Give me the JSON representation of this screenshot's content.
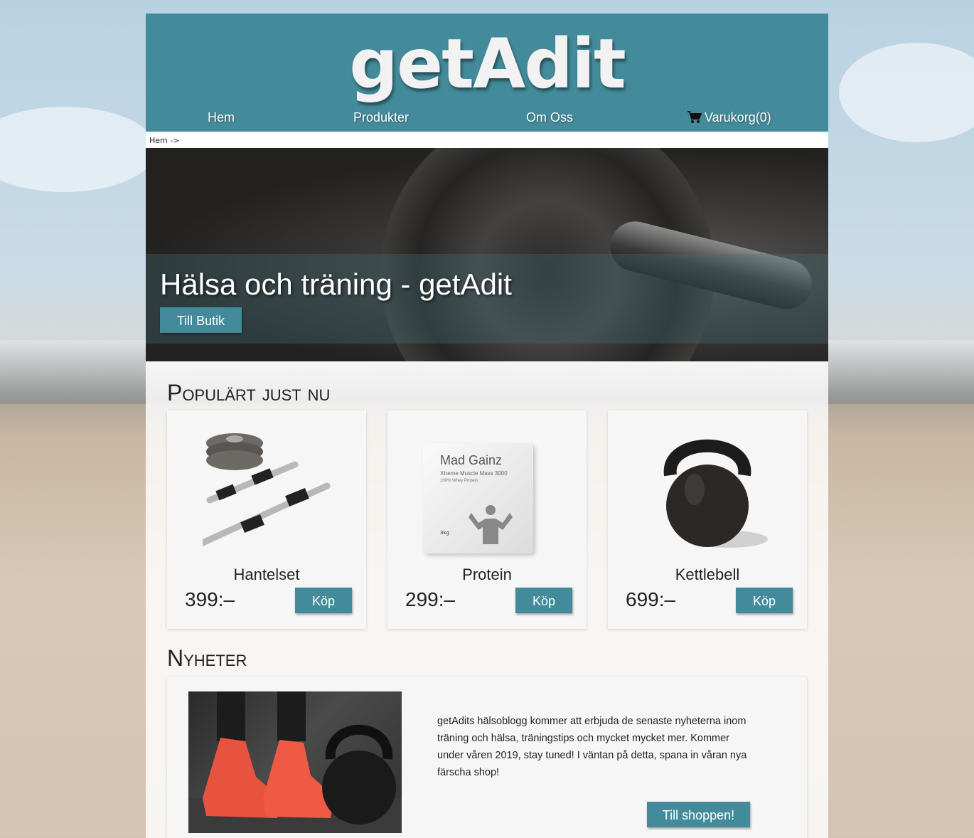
{
  "brand": {
    "logo": "getAdit",
    "accent": "#438b9b"
  },
  "nav": {
    "home": "Hem",
    "products": "Produkter",
    "about": "Om Oss",
    "cart": "Varukorg(0)"
  },
  "breadcrumb": "Hem ->",
  "hero": {
    "title": "Hälsa och träning - getAdit",
    "button": "Till Butik"
  },
  "popular": {
    "title": "Populärt just nu",
    "products": [
      {
        "name": "Hantelset",
        "price": "399:–",
        "button": "Köp"
      },
      {
        "name": "Protein",
        "price": "299:–",
        "button": "Köp"
      },
      {
        "name": "Kettlebell",
        "price": "699:–",
        "button": "Köp"
      }
    ],
    "protein_pack": {
      "brand": "Mad Gainz",
      "line1": "Xtreme Muscle Mass 3000",
      "line2": "100% Whey Protein",
      "weight": "3kg"
    }
  },
  "news": {
    "title": "Nyheter",
    "text": "getAdits hälsoblogg kommer att erbjuda de senaste nyheterna inom träning och hälsa, träningstips och mycket mycket mer. Kommer under våren 2019, stay tuned! I väntan på detta, spana in våran nya färscha shop!",
    "button": "Till shoppen!"
  }
}
